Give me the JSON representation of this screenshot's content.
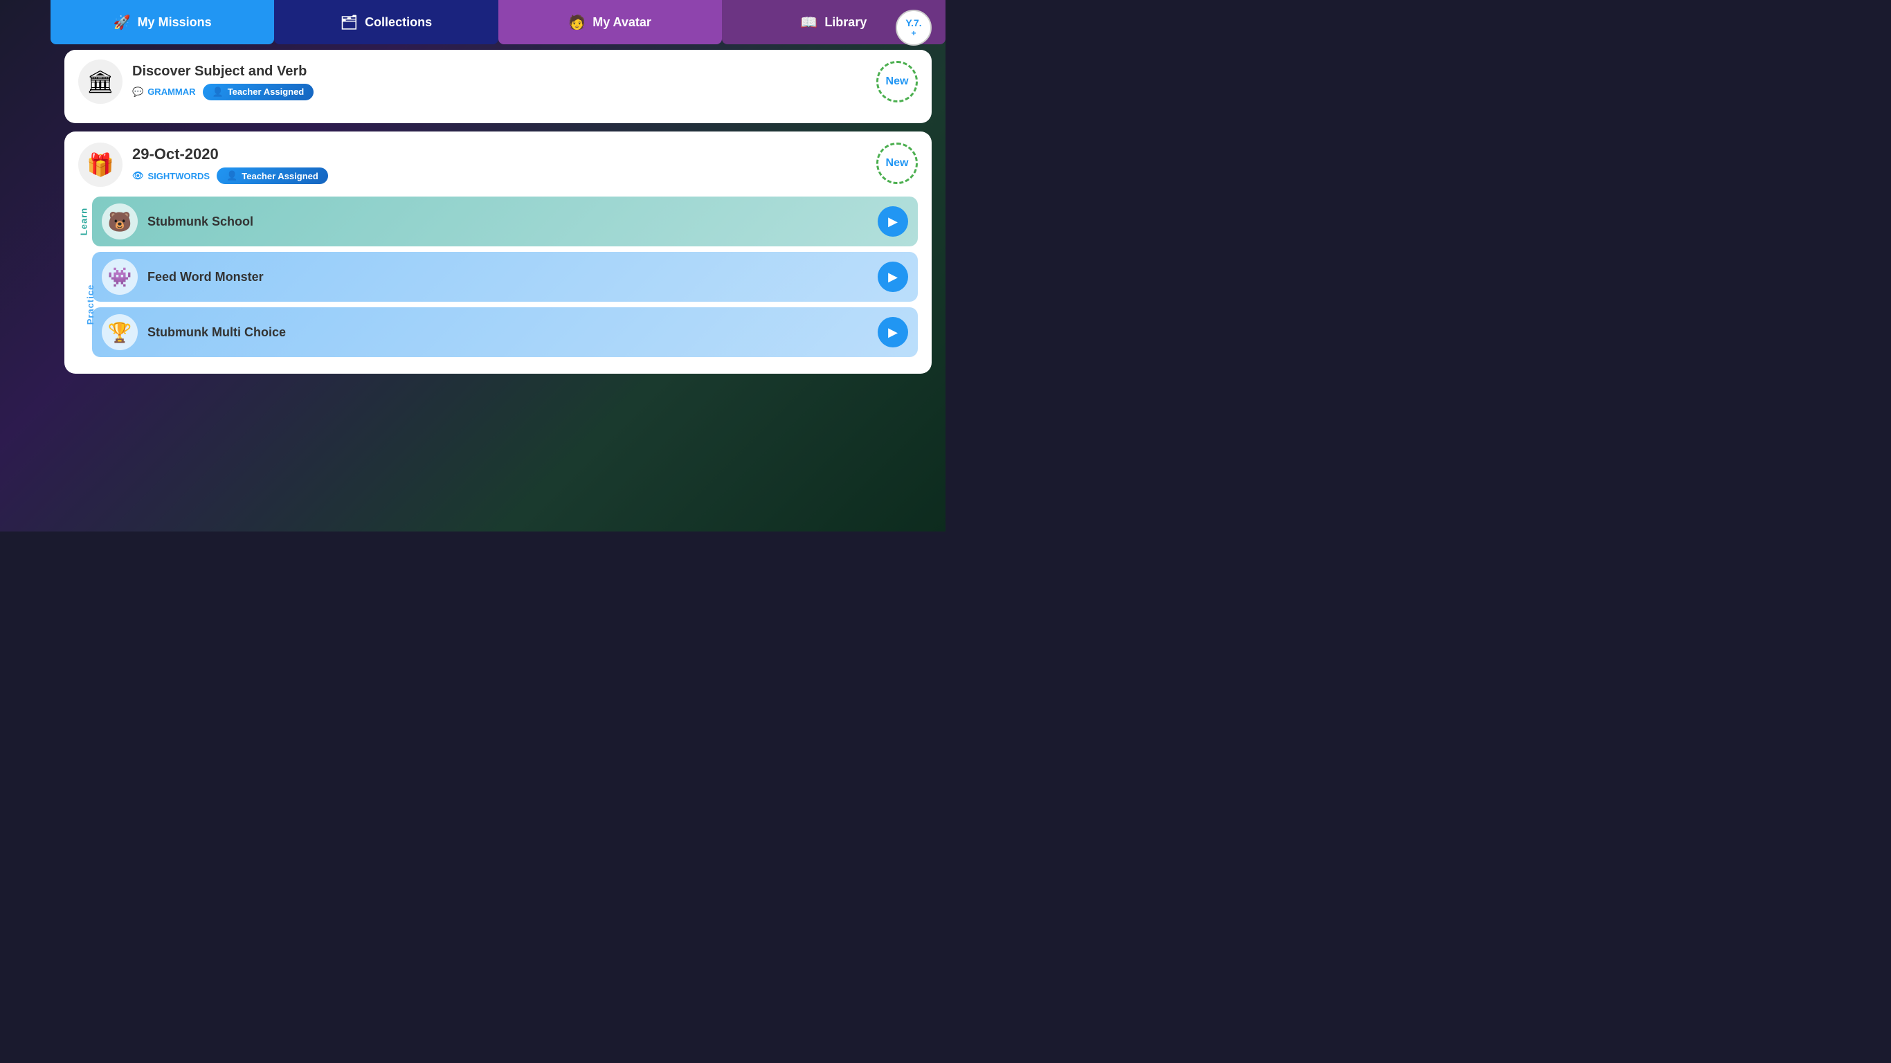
{
  "navbar": {
    "tabs": [
      {
        "id": "my-missions",
        "label": "My Missions",
        "icon": "🚀",
        "style": "active-blue"
      },
      {
        "id": "collections",
        "label": "Collections",
        "icon": "🗂",
        "style": "dark-blue"
      },
      {
        "id": "my-avatar",
        "label": "My Avatar",
        "icon": "🧑",
        "style": "purple"
      },
      {
        "id": "library",
        "label": "Library",
        "icon": "📖",
        "style": "dark-purple"
      }
    ]
  },
  "avatar": {
    "initials": "Y.7.",
    "plus": "+"
  },
  "partial_card": {
    "title": "Discover Subject and Verb",
    "tag_grammar": "GRAMMAR",
    "tag_assigned": "Teacher Assigned",
    "new_label": "New"
  },
  "mission_card": {
    "date": "29-Oct-2020",
    "tag_sightwords": "SIGHTWORDS",
    "tag_assigned": "Teacher Assigned",
    "new_label": "New",
    "learn_label": "Learn",
    "practice_label": "Practice",
    "activities": [
      {
        "id": "stubmunk-school",
        "title": "Stubmunk School",
        "type": "learn",
        "icon": "🐻"
      },
      {
        "id": "feed-word-monster",
        "title": "Feed Word Monster",
        "type": "practice",
        "icon": "👾"
      },
      {
        "id": "stubmunk-multi-choice",
        "title": "Stubmunk Multi Choice",
        "type": "practice",
        "icon": "🏆"
      }
    ]
  }
}
